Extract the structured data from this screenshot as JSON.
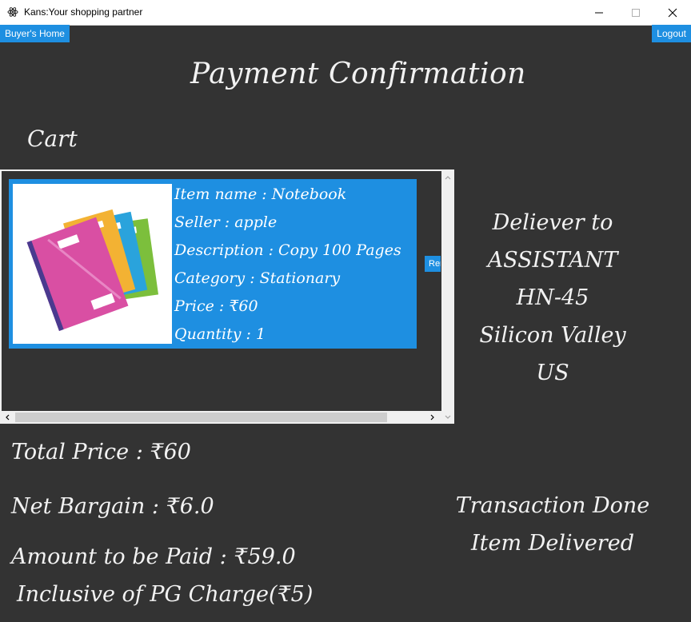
{
  "window": {
    "title": "Kans:Your shopping partner"
  },
  "nav": {
    "buyers_home": "Buyer's Home",
    "logout": "Logout"
  },
  "page": {
    "title": "Payment Confirmation",
    "cart_heading": "Cart"
  },
  "cart": {
    "items": [
      {
        "image": "notebooks-image",
        "name": "Item name : Notebook",
        "seller": "Seller : apple",
        "description": "Description : Copy 100 Pages",
        "category": "Category : Stationary",
        "price": "Price : ₹60",
        "quantity": "Quantity : 1",
        "remove_label": "Remove"
      }
    ]
  },
  "delivery": {
    "heading": "Deliever to",
    "name": "ASSISTANT",
    "house": "HN-45",
    "city": "Silicon Valley",
    "country": "US"
  },
  "summary": {
    "total": "Total Price : ₹60",
    "bargain": "Net Bargain : ₹6.0",
    "amount": "Amount to be Paid : ₹59.0",
    "pg_note": "Inclusive of PG Charge(₹5)"
  },
  "status": {
    "line1": "Transaction Done",
    "line2": "Item Delivered"
  },
  "colors": {
    "background": "#333333",
    "accent": "#1e8fe1",
    "text": "#f2f2f2"
  }
}
